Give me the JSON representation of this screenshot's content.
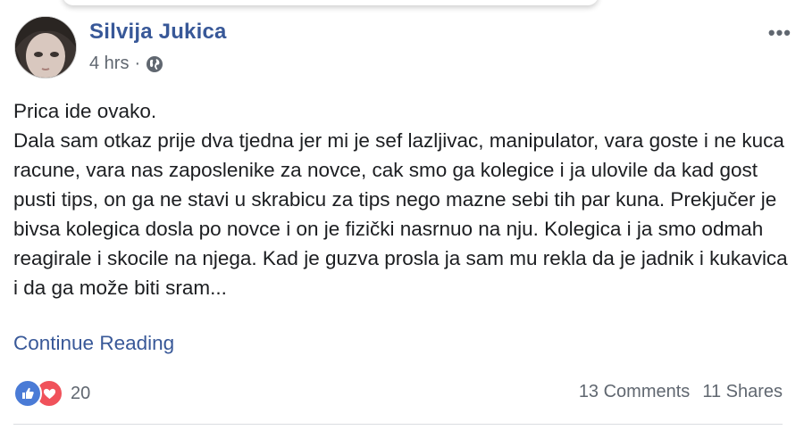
{
  "post": {
    "author": "Silvija Jukica",
    "time": "4 hrs",
    "separator": "·",
    "privacy_icon": "globe-icon",
    "more_label": "•••",
    "paragraphs": [
      "Prica ide ovako.",
      "Dala sam otkaz prije dva tjedna jer mi je sef lazljivac, manipulator, vara goste i ne kuca racune, vara nas zaposlenike za novce, cak smo ga kolegice i ja ulovile da kad gost pusti tips, on ga ne stavi u skrabicu za tips nego mazne sebi tih par kuna. Prekjučer je bivsa kolegica dosla po novce i on je fizički nasrnuo na nju. Kolegica i ja smo odmah reagirale i skocile na njega. Kad je guzva prosla ja sam mu rekla da je jadnik i kukavica i da ga može biti sram..."
    ],
    "continue_label": "Continue Reading"
  },
  "footer": {
    "reaction_icons": [
      "like-icon",
      "love-icon"
    ],
    "reaction_count": "20",
    "comments": "13 Comments",
    "shares": "11 Shares"
  },
  "colors": {
    "link": "#385898",
    "text": "#1c1e21",
    "muted": "#606770",
    "like": "#4a7bd6",
    "love": "#f0525b"
  }
}
